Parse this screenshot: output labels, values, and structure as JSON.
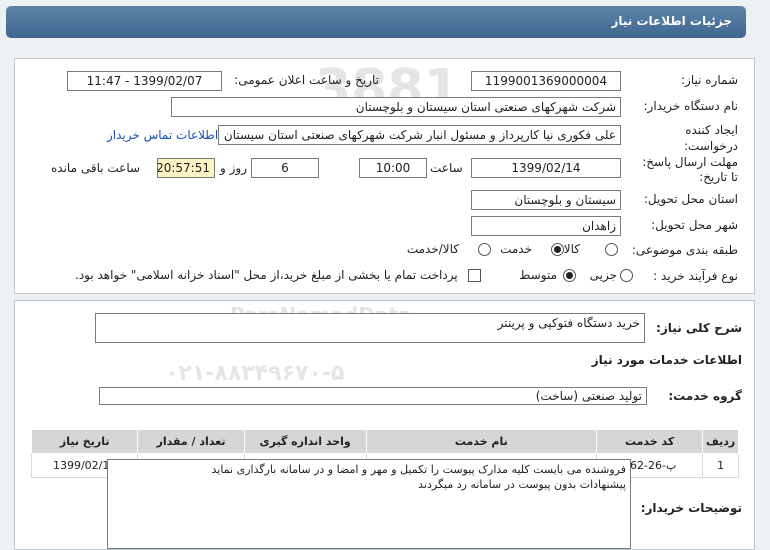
{
  "header": {
    "title": "جزئیات اطلاعات نیاز"
  },
  "fields": {
    "need_number_label": "شماره نیاز:",
    "need_number": "1199001369000004",
    "announce_label": "تاریخ و ساعت اعلان عمومی:",
    "announce_value": "1399/02/07 - 11:47",
    "buyer_org_label": "نام دستگاه خریدار:",
    "buyer_org": "شرکت شهرکهای صنعتی استان سیستان و بلوچستان",
    "creator_label": "ایجاد کننده درخواست:",
    "creator": "علی  فکوری نیا کارپرداز و مسئول انبار شرکت شهرکهای صنعتی استان سیستان و بلوچستان",
    "contact_link": "اطلاعات تماس خریدار",
    "deadline_label": "مهلت ارسال پاسخ: تا تاریخ:",
    "deadline_date": "1399/02/14",
    "time_label": "ساعت",
    "deadline_time": "10:00",
    "days_value": "6",
    "days_label": "روز و",
    "remaining": "20:57:51",
    "remaining_label": "ساعت باقی مانده",
    "province_label": "استان محل تحویل:",
    "province": "سیستان و بلوچستان",
    "city_label": "شهر محل تحویل:",
    "city": "زاهدان",
    "category_label": "طبقه بندی موضوعی:",
    "category_options": [
      "کالا",
      "خدمت",
      "کالا/خدمت"
    ],
    "category_selected": "خدمت",
    "process_label": "نوع فرآیند خرید :",
    "process_options": [
      "جزیی",
      "متوسط"
    ],
    "process_selected": "متوسط",
    "payment_note": "پرداخت تمام یا بخشی از مبلغ خرید،از محل \"اسناد خزانه اسلامی\" خواهد بود."
  },
  "details": {
    "summary_label": "شرح کلی نیاز:",
    "summary": "خرید دستگاه فتوکپی و پرینتر",
    "services_title": "اطلاعات خدمات مورد نیاز",
    "service_group_label": "گروه خدمت:",
    "service_group": "تولید صنعتی (ساخت)",
    "table_headers": [
      "ردیف",
      "کد خدمت",
      "نام خدمت",
      "واحد اندازه گیری",
      "تعداد / مقدار",
      "تاریخ نیاز"
    ],
    "table_rows": [
      [
        "1",
        "پ-26-262",
        "تولید رایانه و تجهیزات جانبی",
        "مرحله",
        "1",
        "1399/02/14"
      ]
    ],
    "buyer_notes_label": "توضیحات خریدار:",
    "buyer_notes": "فروشنده می بایست کلیه مدارک پیوست را تکمیل و مهر و امضا و در سامانه بارگذاری نماید\nپیشنهادات بدون پیوست در سامانه رد میگردند"
  }
}
